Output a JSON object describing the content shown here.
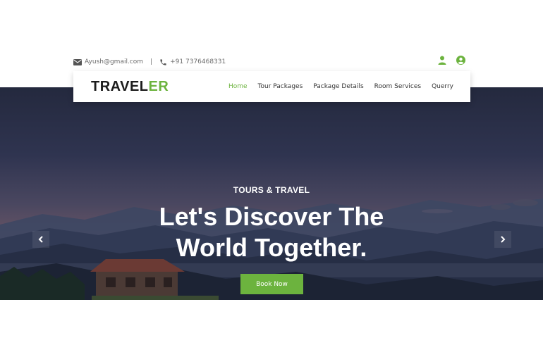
{
  "contact": {
    "email": "Ayush@gmail.com",
    "separator": "|",
    "phone": "+91 7376468331"
  },
  "brand": {
    "logo_main": "TRAVEL",
    "logo_accent": "ER"
  },
  "nav": {
    "items": [
      {
        "label": "Home",
        "active": true
      },
      {
        "label": "Tour Packages",
        "active": false
      },
      {
        "label": "Package Details",
        "active": false
      },
      {
        "label": "Room Services",
        "active": false
      },
      {
        "label": "Querry",
        "active": false
      }
    ]
  },
  "hero": {
    "subtitle": "TOURS & TRAVEL",
    "headline_line1": "Let's Discover The",
    "headline_line2": "World Together.",
    "cta_label": "Book Now"
  },
  "icons": {
    "email": "envelope-icon",
    "phone": "phone-icon",
    "user": "user-icon",
    "account": "user-circle-icon",
    "prev": "chevron-left-icon",
    "next": "chevron-right-icon"
  },
  "colors": {
    "accent": "#6cb33e",
    "text_dark": "#1c1c1c",
    "text_muted": "#6b6b6b"
  }
}
